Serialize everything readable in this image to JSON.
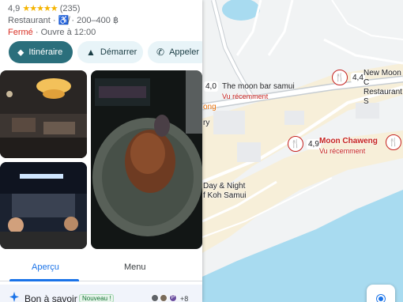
{
  "place": {
    "rating": "4,9",
    "stars": "★★★★★",
    "review_count": "(235)",
    "category": "Restaurant",
    "price_range": "· 200–400 ฿",
    "status_closed": "Fermé",
    "opens": "· Ouvre à 12:00"
  },
  "actions": {
    "directions": "Itinéraire",
    "start": "Démarrer",
    "call": "Appeler"
  },
  "tabs": {
    "overview": "Aperçu",
    "menu": "Menu"
  },
  "good_to_know": {
    "label": "Bon à savoir",
    "badge": "Nouveau !",
    "avatar_letter": "P",
    "extra_count": "+8"
  },
  "map": {
    "markers": [
      {
        "rating": "4,0",
        "name": "The moon bar samui",
        "sub": "Vu récemment"
      },
      {
        "rating": "4,4",
        "name_line1": "New Moon C",
        "name_line2": "Restaurant S"
      },
      {
        "rating": "4,9",
        "name": "Moon Chaweng",
        "sub": "Vu récemment"
      },
      {
        "rating": "4,"
      }
    ],
    "partial_labels": [
      "ong",
      "ry",
      "Day & Night",
      "f Koh Samui"
    ]
  },
  "colors": {
    "primary_button": "#2b6f7c",
    "secondary_button": "#e8f4f8",
    "closed_red": "#d93025",
    "pin_red": "#c5221f",
    "accent_blue": "#1a73e8",
    "sea": "#a8dbf0"
  }
}
